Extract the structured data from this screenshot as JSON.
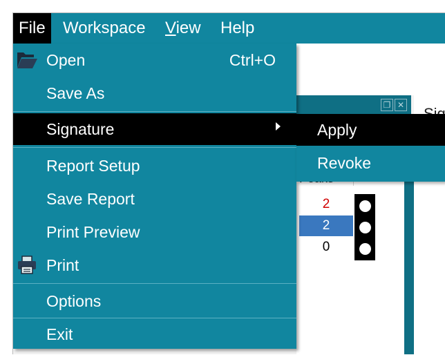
{
  "menubar": {
    "file": "File",
    "workspace": "Workspace",
    "view": "View",
    "help": "Help"
  },
  "background": {
    "tab_partial": "Sig",
    "column_header": "Peaks",
    "peak_values": [
      "2",
      "2",
      "0"
    ]
  },
  "file_menu": {
    "open": "Open",
    "open_shortcut": "Ctrl+O",
    "save_as": "Save As",
    "signature": "Signature",
    "report_setup": "Report Setup",
    "save_report": "Save Report",
    "print_preview": "Print Preview",
    "print": "Print",
    "options": "Options",
    "exit": "Exit"
  },
  "signature_submenu": {
    "apply": "Apply",
    "revoke": "Revoke"
  },
  "icons": {
    "open": "folder-open-icon",
    "print": "printer-icon",
    "submenu": "chevron-right-icon"
  },
  "colors": {
    "menu_bg": "#11869f",
    "highlight": "#000000",
    "text": "#ffffff"
  }
}
